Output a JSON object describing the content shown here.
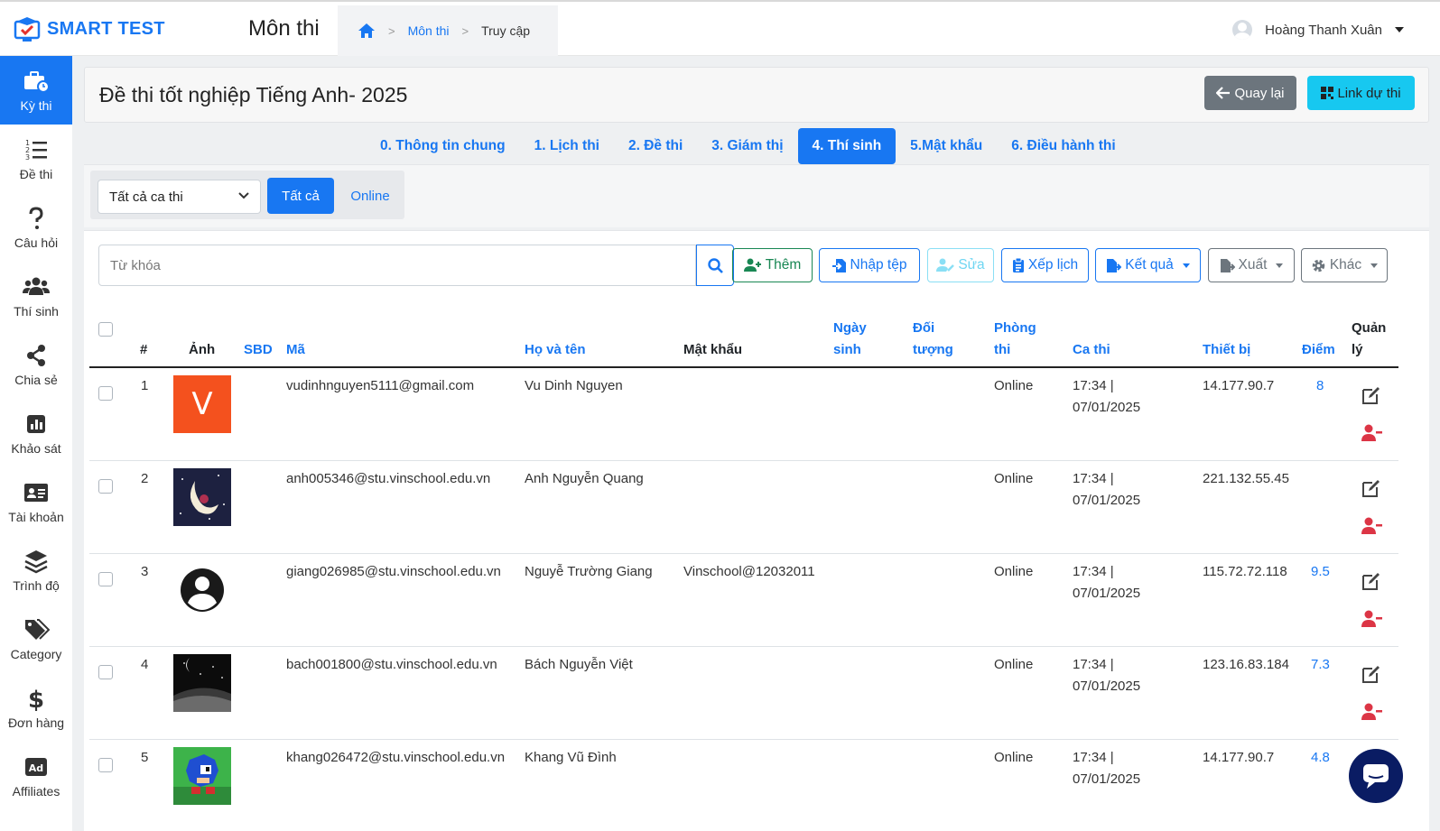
{
  "app": {
    "name": "SMART TEST"
  },
  "header": {
    "page_title": "Môn thi",
    "breadcrumb": {
      "item1": "Môn thi",
      "item2": "Truy cập"
    },
    "user_name": "Hoàng Thanh Xuân"
  },
  "sidebar": {
    "items": [
      {
        "label": "Kỳ thi",
        "icon": "briefcase-clock-icon"
      },
      {
        "label": "Đề thi",
        "icon": "list-ordered-icon"
      },
      {
        "label": "Câu hỏi",
        "icon": "question-icon"
      },
      {
        "label": "Thí sinh",
        "icon": "users-icon"
      },
      {
        "label": "Chia sẻ",
        "icon": "share-icon"
      },
      {
        "label": "Khảo sát",
        "icon": "chart-icon"
      },
      {
        "label": "Tài khoản",
        "icon": "id-card-icon"
      },
      {
        "label": "Trình độ",
        "icon": "layers-icon"
      },
      {
        "label": "Category",
        "icon": "tags-icon"
      },
      {
        "label": "Đơn hàng",
        "icon": "dollar-icon"
      },
      {
        "label": "Affiliates",
        "icon": "ad-icon"
      }
    ]
  },
  "exam": {
    "title": "Đề thi tốt nghiệp Tiếng Anh- 2025",
    "back_label": "Quay lại",
    "link_label": "Link dự thi"
  },
  "tabs": [
    {
      "label": "0. Thông tin chung"
    },
    {
      "label": "1. Lịch thi"
    },
    {
      "label": "2. Đề thi"
    },
    {
      "label": "3. Giám thị"
    },
    {
      "label": "4. Thí sinh"
    },
    {
      "label": "5.Mật khẩu"
    },
    {
      "label": "6. Điều hành thi"
    }
  ],
  "filters": {
    "session_select": "Tất cả ca thi",
    "all_label": "Tất cả",
    "online_label": "Online"
  },
  "toolbar": {
    "search_placeholder": "Từ khóa",
    "add": "Thêm",
    "import": "Nhập tệp",
    "edit": "Sửa",
    "schedule": "Xếp lịch",
    "result": "Kết quả",
    "export": "Xuất",
    "other": "Khác"
  },
  "table": {
    "headers": {
      "index": "#",
      "photo": "Ảnh",
      "sbd": "SBD",
      "code": "Mã",
      "name": "Họ và tên",
      "password": "Mật khẩu",
      "dob_1": "Ngày",
      "dob_2": "sinh",
      "target_1": "Đối",
      "target_2": "tượng",
      "room_1": "Phòng",
      "room_2": "thi",
      "session": "Ca thi",
      "device": "Thiết bị",
      "score": "Điểm",
      "manage_1": "Quản",
      "manage_2": "lý"
    },
    "rows": [
      {
        "index": "1",
        "code": "vudinhnguyen5111@gmail.com",
        "name": "Vu Dinh Nguyen",
        "password": "",
        "room": "Online",
        "time": "17:34 |",
        "date": "07/01/2025",
        "device": "14.177.90.7",
        "score": "8",
        "photo_letter": "V"
      },
      {
        "index": "2",
        "code": "anh005346@stu.vinschool.edu.vn",
        "name": "Anh Nguyễn Quang",
        "password": "",
        "room": "Online",
        "time": "17:34 |",
        "date": "07/01/2025",
        "device": "221.132.55.45",
        "score": ""
      },
      {
        "index": "3",
        "code": "giang026985@stu.vinschool.edu.vn",
        "name": "Nguyễ Trường Giang",
        "password": "Vinschool@12032011",
        "room": "Online",
        "time": "17:34 |",
        "date": "07/01/2025",
        "device": "115.72.72.118",
        "score": "9.5"
      },
      {
        "index": "4",
        "code": "bach001800@stu.vinschool.edu.vn",
        "name": "Bách Nguyễn Việt",
        "password": "",
        "room": "Online",
        "time": "17:34 |",
        "date": "07/01/2025",
        "device": "123.16.83.184",
        "score": "7.3"
      },
      {
        "index": "5",
        "code": "khang026472@stu.vinschool.edu.vn",
        "name": "Khang Vũ Đình",
        "password": "",
        "room": "Online",
        "time": "17:34 |",
        "date": "07/01/2025",
        "device": "14.177.90.7",
        "score": "4.8"
      }
    ]
  },
  "colors": {
    "primary": "#1877f2",
    "success": "#198754",
    "danger": "#dc3545",
    "info": "#17c8f0",
    "secondary": "#6c757d"
  }
}
